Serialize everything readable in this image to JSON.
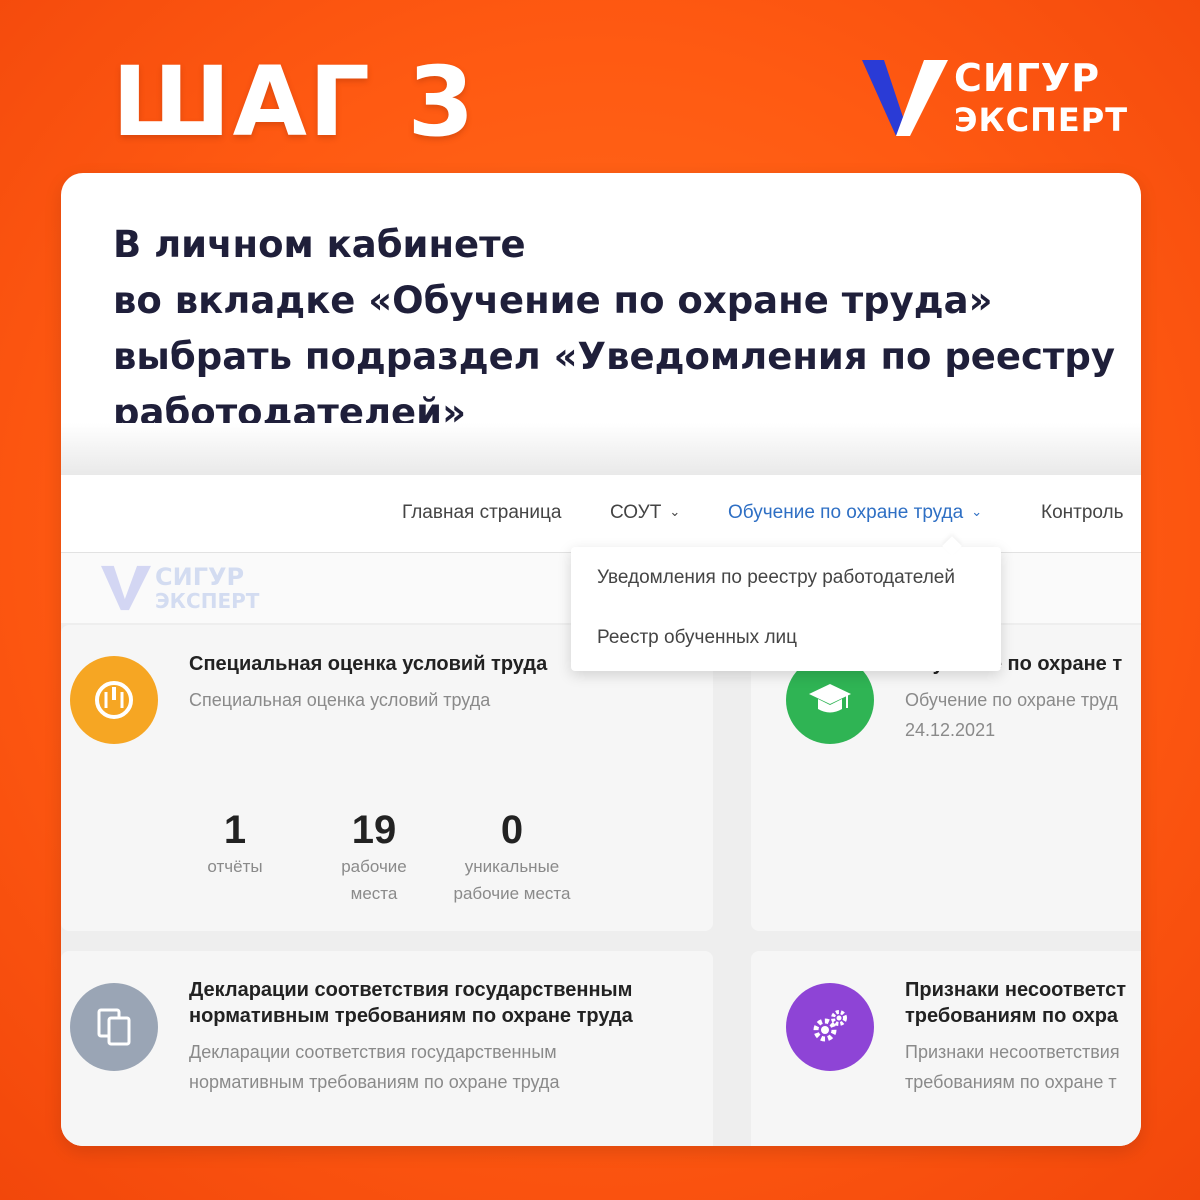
{
  "header": {
    "step_title": "ШАГ 3",
    "logo_line1": "СИГУР",
    "logo_line2": "ЭКСПЕРТ"
  },
  "instruction": {
    "lines": [
      "В личном кабинете",
      "во вкладке «Обучение по охране труда»",
      "выбрать подраздел «Уведомления по реестру",
      "работодателей»"
    ]
  },
  "nav": {
    "items": [
      {
        "label": "Главная страница"
      },
      {
        "label": "СОУТ"
      },
      {
        "label": "Обучение по охране труда"
      },
      {
        "label": "Контроль"
      }
    ]
  },
  "brand": {
    "line1": "СИГУР",
    "line2": "ЭКСПЕРТ"
  },
  "dropdown": {
    "items": [
      {
        "label": "Уведомления по реестру работодателей"
      },
      {
        "label": "Реестр обученных лиц"
      }
    ]
  },
  "tiles": [
    {
      "title": "Специальная оценка условий труда",
      "subtitle": "Специальная оценка условий труда",
      "icon": "gauge-icon",
      "color": "#f6a623",
      "stats": [
        {
          "value": "1",
          "label_line1": "отчёты",
          "label_line2": ""
        },
        {
          "value": "19",
          "label_line1": "рабочие",
          "label_line2": "места"
        },
        {
          "value": "0",
          "label_line1": "уникальные",
          "label_line2": "рабочие места"
        }
      ]
    },
    {
      "title": "Обучение по охране т",
      "subtitle": "Обучение по охране труд",
      "date": "24.12.2021",
      "icon": "graduation-cap-icon",
      "color": "#2fb454"
    },
    {
      "title_line1": "Декларации соответствия государственным",
      "title_line2": "нормативным требованиям по охране труда",
      "subtitle_line1": "Декларации соответствия государственным",
      "subtitle_line2": "нормативным требованиям по охране труда",
      "icon": "documents-icon",
      "color": "#9aa5b5"
    },
    {
      "title_line1": "Признаки несоответст",
      "title_line2": "требованиям по охра",
      "subtitle_line1": "Признаки несоответствия",
      "subtitle_line2": "требованиям по охране т",
      "icon": "gears-icon",
      "color": "#8e44d6"
    }
  ]
}
